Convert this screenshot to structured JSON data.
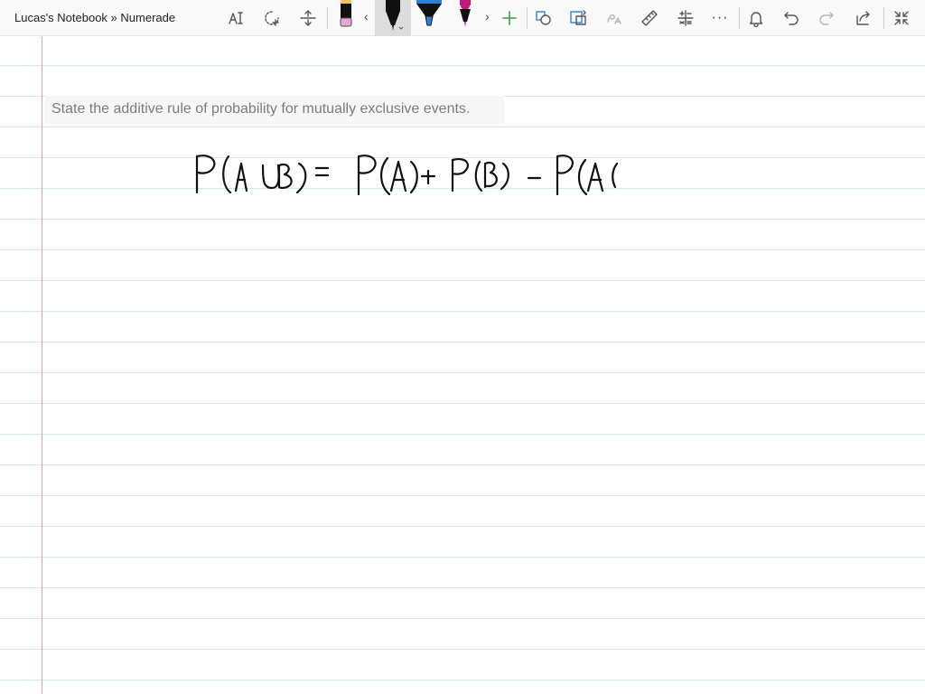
{
  "window": {
    "breadcrumb": "Lucas's Notebook » Numerade"
  },
  "toolbar": {
    "icons": [
      "text-cursor-icon",
      "lasso-select-icon",
      "insert-space-icon",
      "highlighter-pen",
      "pen-black",
      "highlighter-blue",
      "pen-magenta",
      "add-pen-icon",
      "ink-to-shape-icon",
      "ink-to-text-icon",
      "ink-to-math-icon",
      "ruler-icon",
      "math-icon",
      "more-icon",
      "bell-icon",
      "undo-icon",
      "redo-icon",
      "share-icon",
      "fullscreen-exit-icon"
    ],
    "prev_arrow": "‹",
    "next_arrow": "›",
    "more_label": "···",
    "pen_colors": {
      "highlighter_1": "#e7a8d6",
      "pen_black": "#111111",
      "highlighter_blue": "#2f7fd6",
      "pen_magenta": "#c2187e"
    }
  },
  "page": {
    "question_text": "State the additive rule of probability for mutually exclusive events.",
    "ink_text": "P(A∪B) = P(A) + P(B) - P(A"
  },
  "colors": {
    "rule_line": "#cfe7f0",
    "margin_line": "#e8a3a3",
    "ink": "#111111"
  }
}
